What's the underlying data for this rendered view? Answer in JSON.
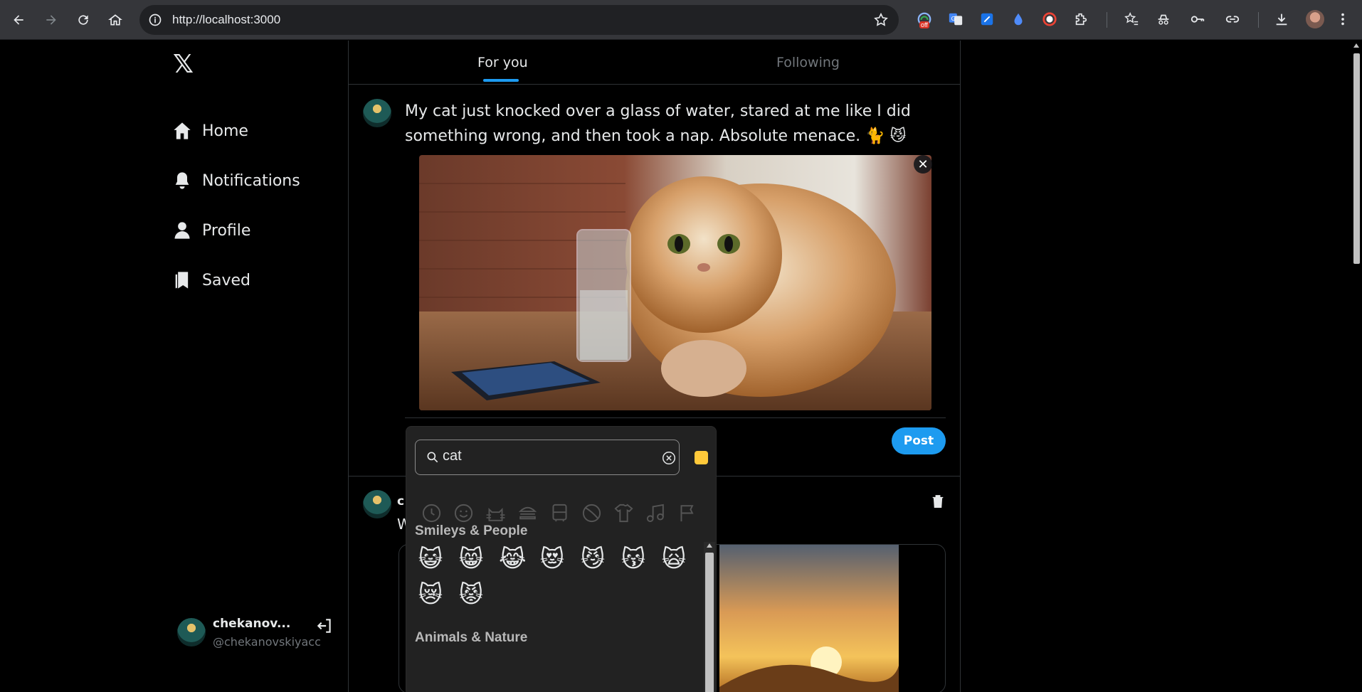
{
  "browser": {
    "url": "http://localhost:3000",
    "ext_badge": "off"
  },
  "sidebar": {
    "logo": "𝕏",
    "items": [
      {
        "label": "Home",
        "icon": "home-icon"
      },
      {
        "label": "Notifications",
        "icon": "bell-icon"
      },
      {
        "label": "Profile",
        "icon": "user-icon"
      },
      {
        "label": "Saved",
        "icon": "bookmark-icon"
      }
    ],
    "user": {
      "name": "chekanov...",
      "handle": "@chekanovskiyacc"
    }
  },
  "tabs": [
    {
      "label": "For you",
      "active": true
    },
    {
      "label": "Following",
      "active": false
    }
  ],
  "composer": {
    "text": "My cat just knocked over a glass of water, stared at me like I did something wrong, and then took a nap. Absolute menace. 🐈 😼",
    "remove_label": "✕",
    "post_label": "Post"
  },
  "post2": {
    "name_fragment": "c",
    "text_fragment": "W"
  },
  "emoji_picker": {
    "search_value": "cat",
    "skin_tone_color": "#ffc93a",
    "categories": [
      "recent",
      "smileys",
      "animals",
      "food",
      "travel",
      "activities",
      "objects",
      "symbols",
      "flags"
    ],
    "sections": [
      {
        "title": "Smileys & People",
        "emojis": [
          "😺",
          "😸",
          "😹",
          "😻",
          "😼",
          "😽",
          "🙀",
          "😿",
          "😾"
        ]
      },
      {
        "title": "Animals & Nature",
        "emojis": []
      }
    ]
  },
  "colors": {
    "accent": "#1d9bf0",
    "background": "#000000",
    "border": "#2f3336"
  }
}
